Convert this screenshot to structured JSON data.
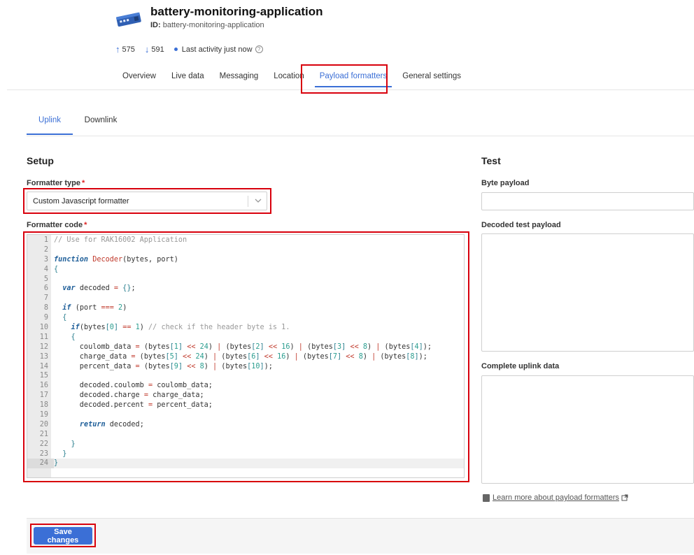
{
  "app": {
    "title": "battery-monitoring-application",
    "id_label": "ID:",
    "id_value": "battery-monitoring-application",
    "uplink_count": "575",
    "downlink_count": "591",
    "last_activity": "Last activity just now",
    "icon": "gateway-device-icon"
  },
  "main_tabs": [
    {
      "label": "Overview"
    },
    {
      "label": "Live data"
    },
    {
      "label": "Messaging"
    },
    {
      "label": "Location"
    },
    {
      "label": "Payload formatters"
    },
    {
      "label": "General settings"
    }
  ],
  "sub_tabs": [
    {
      "label": "Uplink"
    },
    {
      "label": "Downlink"
    }
  ],
  "setup": {
    "title": "Setup",
    "formatter_type_label": "Formatter type",
    "formatter_type_value": "Custom Javascript formatter",
    "formatter_code_label": "Formatter code",
    "required_mark": "*"
  },
  "code_lines": [
    "// Use for RAK16002 Application",
    "",
    "function Decoder(bytes, port)",
    "{",
    "",
    "  var decoded = {};",
    "",
    "  if (port === 2)",
    "  {",
    "    if(bytes[0] == 1) // check if the header byte is 1.",
    "    {",
    "      coulomb_data = (bytes[1] << 24) | (bytes[2] << 16) | (bytes[3] << 8) | (bytes[4]);",
    "      charge_data = (bytes[5] << 24) | (bytes[6] << 16) | (bytes[7] << 8) | (bytes[8]);",
    "      percent_data = (bytes[9] << 8) | (bytes[10]);",
    "",
    "      decoded.coulomb = coulomb_data;",
    "      decoded.charge = charge_data;",
    "      decoded.percent = percent_data;",
    "",
    "      return decoded;",
    "",
    "    }",
    "  }",
    "}"
  ],
  "test": {
    "title": "Test",
    "byte_payload_label": "Byte payload",
    "byte_payload_value": "",
    "decoded_label": "Decoded test payload",
    "complete_label": "Complete uplink data",
    "learn_more": "Learn more about payload formatters"
  },
  "footer": {
    "save_label": "Save changes"
  },
  "colors": {
    "accent": "#3b6fd6",
    "highlight": "#d8000c"
  }
}
